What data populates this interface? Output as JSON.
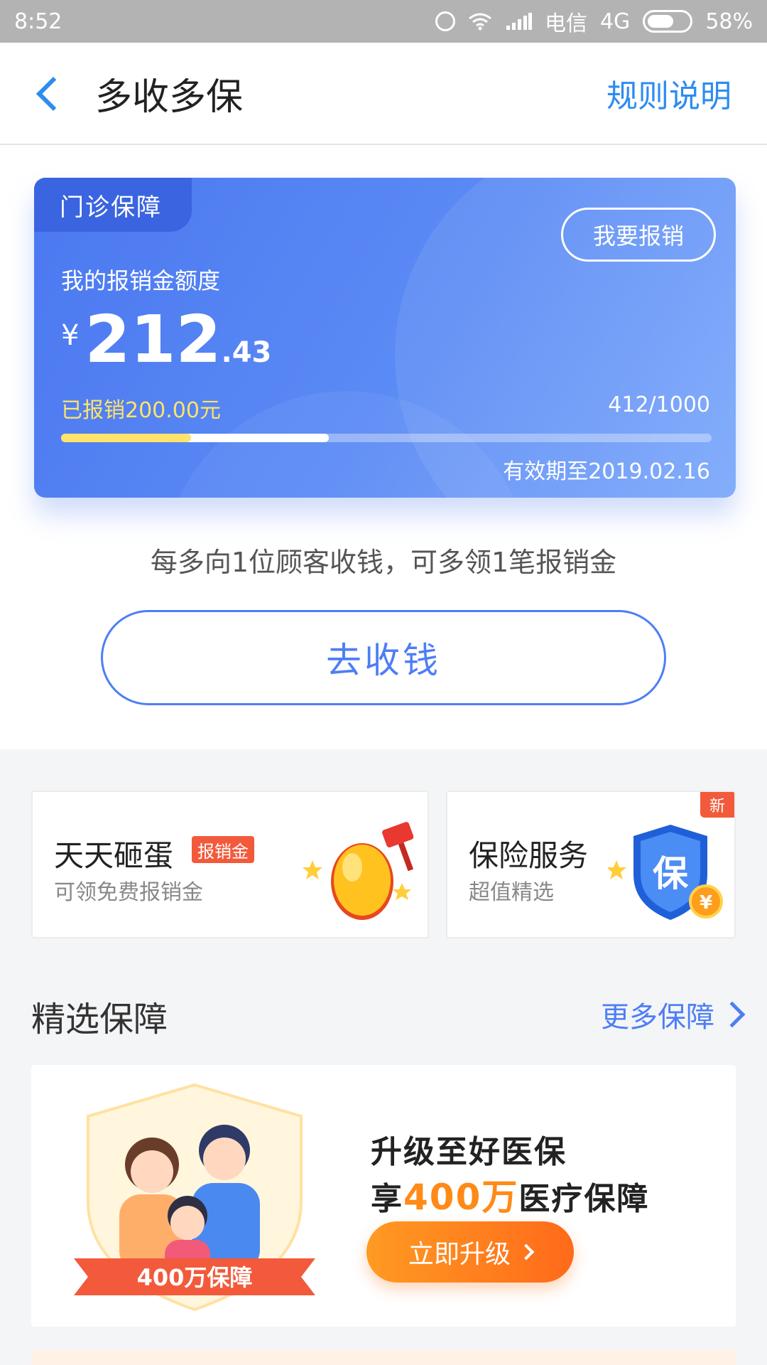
{
  "status_bar": {
    "time": "8:52",
    "carrier": "电信",
    "network": "4G",
    "battery": "58%"
  },
  "nav": {
    "title": "多收多保",
    "rules_label": "规则说明"
  },
  "card": {
    "badge": "门诊保障",
    "claim_button": "我要报销",
    "quota_label": "我的报销金额度",
    "currency": "¥",
    "amount_integer": "212",
    "amount_decimal": ".43",
    "reimbursed": "已报销200.00元",
    "progress_text": "412/1000",
    "progress_fraction": 0.412,
    "reimbursed_fraction": 0.2,
    "valid_until": "有效期至2019.02.16"
  },
  "hint": "每多向1位顾客收钱，可多领1笔报销金",
  "collect_button": "去收钱",
  "tiles": [
    {
      "title": "天天砸蛋",
      "tag": "报销金",
      "subtitle": "可领免费报销金"
    },
    {
      "title": "保险服务",
      "tag": "新",
      "subtitle": "超值精选",
      "shield_text": "保",
      "coin_text": "¥"
    }
  ],
  "section": {
    "title": "精选保障",
    "more_label": "更多保障"
  },
  "promo": {
    "line1": "升级至好医保",
    "line2_prefix": "享",
    "line2_accent": "400万",
    "line2_suffix": "医疗保障",
    "button": "立即升级",
    "ribbon": "400万保障"
  },
  "colors": {
    "accent_blue": "#2d8cf0",
    "card_blue": "#4b78f0",
    "highlight_yellow": "#ffe36a",
    "orange": "#ff8a17",
    "red_tag": "#f25a3b"
  }
}
